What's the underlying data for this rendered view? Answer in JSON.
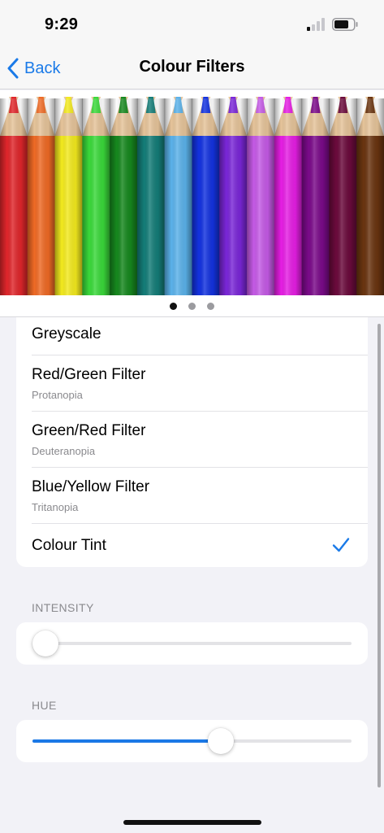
{
  "status_bar": {
    "time": "9:29"
  },
  "nav": {
    "back_label": "Back",
    "title": "Colour Filters"
  },
  "hero": {
    "pencil_colors": [
      "#e0262b",
      "#ef6a25",
      "#f3ea1e",
      "#3ad93a",
      "#16881e",
      "#147d78",
      "#5bb2ea",
      "#1332e0",
      "#7a26d8",
      "#c55ae6",
      "#e61ee4",
      "#7b0a8a",
      "#6b0a3c",
      "#6a3410"
    ],
    "page_count": 3,
    "active_page": 1
  },
  "filters": [
    {
      "label": "Greyscale",
      "sub": "",
      "selected": false
    },
    {
      "label": "Red/Green Filter",
      "sub": "Protanopia",
      "selected": false
    },
    {
      "label": "Green/Red Filter",
      "sub": "Deuteranopia",
      "selected": false
    },
    {
      "label": "Blue/Yellow Filter",
      "sub": "Tritanopia",
      "selected": false
    },
    {
      "label": "Colour Tint",
      "sub": "",
      "selected": true
    }
  ],
  "intensity": {
    "header": "INTENSITY",
    "value": 0.04
  },
  "hue": {
    "header": "HUE",
    "value": 0.59
  },
  "colors": {
    "accent": "#1a7ae8",
    "background": "#f2f2f7"
  }
}
